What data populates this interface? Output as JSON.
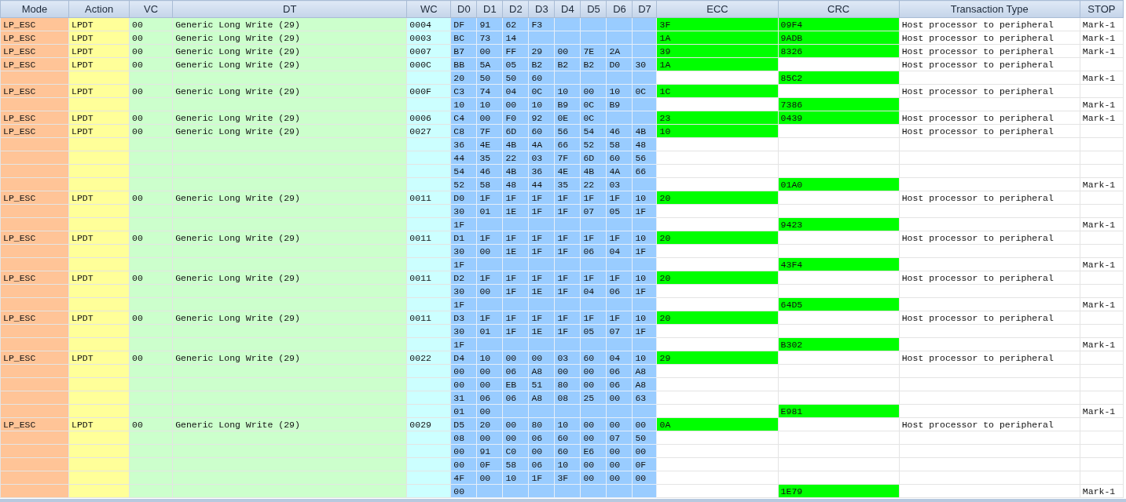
{
  "table": {
    "columns": [
      "Mode",
      "Action",
      "VC",
      "DT",
      "WC",
      "D0",
      "D1",
      "D2",
      "D3",
      "D4",
      "D5",
      "D6",
      "D7",
      "ECC",
      "CRC",
      "Transaction Type",
      "STOP"
    ],
    "rows": [
      {
        "mode": "LP_ESC",
        "action": "LPDT",
        "vc": "00",
        "dt": "Generic Long Write (29)",
        "wc": "0004",
        "data": [
          "DF",
          "91",
          "62",
          "F3"
        ],
        "ecc": "3F",
        "crc": "09F4",
        "transaction_type": "Host processor to peripheral",
        "stop": "Mark-1"
      },
      {
        "mode": "LP_ESC",
        "action": "LPDT",
        "vc": "00",
        "dt": "Generic Long Write (29)",
        "wc": "0003",
        "data": [
          "BC",
          "73",
          "14"
        ],
        "ecc": "1A",
        "crc": "9ADB",
        "transaction_type": "Host processor to peripheral",
        "stop": "Mark-1"
      },
      {
        "mode": "LP_ESC",
        "action": "LPDT",
        "vc": "00",
        "dt": "Generic Long Write (29)",
        "wc": "0007",
        "data": [
          "B7",
          "00",
          "FF",
          "29",
          "00",
          "7E",
          "2A"
        ],
        "ecc": "39",
        "crc": "8326",
        "transaction_type": "Host processor to peripheral",
        "stop": "Mark-1"
      },
      {
        "mode": "LP_ESC",
        "action": "LPDT",
        "vc": "00",
        "dt": "Generic Long Write (29)",
        "wc": "000C",
        "data": [
          "BB",
          "5A",
          "05",
          "B2",
          "B2",
          "B2",
          "D0",
          "30"
        ],
        "ecc": "1A",
        "transaction_type": "Host processor to peripheral"
      },
      {
        "data": [
          "20",
          "50",
          "50",
          "60"
        ],
        "crc": "85C2",
        "stop": "Mark-1"
      },
      {
        "mode": "LP_ESC",
        "action": "LPDT",
        "vc": "00",
        "dt": "Generic Long Write (29)",
        "wc": "000F",
        "data": [
          "C3",
          "74",
          "04",
          "0C",
          "10",
          "00",
          "10",
          "0C"
        ],
        "ecc": "1C",
        "transaction_type": "Host processor to peripheral"
      },
      {
        "data": [
          "10",
          "10",
          "00",
          "10",
          "B9",
          "0C",
          "B9"
        ],
        "crc": "7386",
        "stop": "Mark-1"
      },
      {
        "mode": "LP_ESC",
        "action": "LPDT",
        "vc": "00",
        "dt": "Generic Long Write (29)",
        "wc": "0006",
        "data": [
          "C4",
          "00",
          "F0",
          "92",
          "0E",
          "0C"
        ],
        "ecc": "23",
        "crc": "0439",
        "transaction_type": "Host processor to peripheral",
        "stop": "Mark-1"
      },
      {
        "mode": "LP_ESC",
        "action": "LPDT",
        "vc": "00",
        "dt": "Generic Long Write (29)",
        "wc": "0027",
        "data": [
          "C8",
          "7F",
          "6D",
          "60",
          "56",
          "54",
          "46",
          "4B"
        ],
        "ecc": "10",
        "transaction_type": "Host processor to peripheral"
      },
      {
        "data": [
          "36",
          "4E",
          "4B",
          "4A",
          "66",
          "52",
          "58",
          "48"
        ]
      },
      {
        "data": [
          "44",
          "35",
          "22",
          "03",
          "7F",
          "6D",
          "60",
          "56"
        ]
      },
      {
        "data": [
          "54",
          "46",
          "4B",
          "36",
          "4E",
          "4B",
          "4A",
          "66"
        ]
      },
      {
        "data": [
          "52",
          "58",
          "48",
          "44",
          "35",
          "22",
          "03"
        ],
        "crc": "01A0",
        "stop": "Mark-1"
      },
      {
        "mode": "LP_ESC",
        "action": "LPDT",
        "vc": "00",
        "dt": "Generic Long Write (29)",
        "wc": "0011",
        "data": [
          "D0",
          "1F",
          "1F",
          "1F",
          "1F",
          "1F",
          "1F",
          "10"
        ],
        "ecc": "20",
        "transaction_type": "Host processor to peripheral"
      },
      {
        "data": [
          "30",
          "01",
          "1E",
          "1F",
          "1F",
          "07",
          "05",
          "1F"
        ]
      },
      {
        "data": [
          "1F"
        ],
        "crc": "9423",
        "stop": "Mark-1"
      },
      {
        "mode": "LP_ESC",
        "action": "LPDT",
        "vc": "00",
        "dt": "Generic Long Write (29)",
        "wc": "0011",
        "data": [
          "D1",
          "1F",
          "1F",
          "1F",
          "1F",
          "1F",
          "1F",
          "10"
        ],
        "ecc": "20",
        "transaction_type": "Host processor to peripheral"
      },
      {
        "data": [
          "30",
          "00",
          "1E",
          "1F",
          "1F",
          "06",
          "04",
          "1F"
        ]
      },
      {
        "data": [
          "1F"
        ],
        "crc": "43F4",
        "stop": "Mark-1"
      },
      {
        "mode": "LP_ESC",
        "action": "LPDT",
        "vc": "00",
        "dt": "Generic Long Write (29)",
        "wc": "0011",
        "data": [
          "D2",
          "1F",
          "1F",
          "1F",
          "1F",
          "1F",
          "1F",
          "10"
        ],
        "ecc": "20",
        "transaction_type": "Host processor to peripheral"
      },
      {
        "data": [
          "30",
          "00",
          "1F",
          "1E",
          "1F",
          "04",
          "06",
          "1F"
        ]
      },
      {
        "data": [
          "1F"
        ],
        "crc": "64D5",
        "stop": "Mark-1"
      },
      {
        "mode": "LP_ESC",
        "action": "LPDT",
        "vc": "00",
        "dt": "Generic Long Write (29)",
        "wc": "0011",
        "data": [
          "D3",
          "1F",
          "1F",
          "1F",
          "1F",
          "1F",
          "1F",
          "10"
        ],
        "ecc": "20",
        "transaction_type": "Host processor to peripheral"
      },
      {
        "data": [
          "30",
          "01",
          "1F",
          "1E",
          "1F",
          "05",
          "07",
          "1F"
        ]
      },
      {
        "data": [
          "1F"
        ],
        "crc": "B302",
        "stop": "Mark-1"
      },
      {
        "mode": "LP_ESC",
        "action": "LPDT",
        "vc": "00",
        "dt": "Generic Long Write (29)",
        "wc": "0022",
        "data": [
          "D4",
          "10",
          "00",
          "00",
          "03",
          "60",
          "04",
          "10"
        ],
        "ecc": "29",
        "transaction_type": "Host processor to peripheral"
      },
      {
        "data": [
          "00",
          "00",
          "06",
          "A8",
          "00",
          "00",
          "06",
          "A8"
        ]
      },
      {
        "data": [
          "00",
          "00",
          "EB",
          "51",
          "80",
          "00",
          "06",
          "A8"
        ]
      },
      {
        "data": [
          "31",
          "06",
          "06",
          "A8",
          "08",
          "25",
          "00",
          "63"
        ]
      },
      {
        "data": [
          "01",
          "00"
        ],
        "crc": "E981",
        "stop": "Mark-1"
      },
      {
        "mode": "LP_ESC",
        "action": "LPDT",
        "vc": "00",
        "dt": "Generic Long Write (29)",
        "wc": "0029",
        "data": [
          "D5",
          "20",
          "00",
          "80",
          "10",
          "00",
          "00",
          "00"
        ],
        "ecc": "0A",
        "transaction_type": "Host processor to peripheral"
      },
      {
        "data": [
          "08",
          "00",
          "00",
          "06",
          "60",
          "00",
          "07",
          "50"
        ]
      },
      {
        "data": [
          "00",
          "91",
          "C0",
          "00",
          "60",
          "E6",
          "00",
          "00"
        ]
      },
      {
        "data": [
          "00",
          "0F",
          "58",
          "06",
          "10",
          "00",
          "00",
          "0F"
        ]
      },
      {
        "data": [
          "4F",
          "00",
          "10",
          "1F",
          "3F",
          "00",
          "00",
          "00"
        ]
      },
      {
        "data": [
          "00"
        ],
        "crc": "1E79",
        "stop": "Mark-1"
      }
    ]
  }
}
